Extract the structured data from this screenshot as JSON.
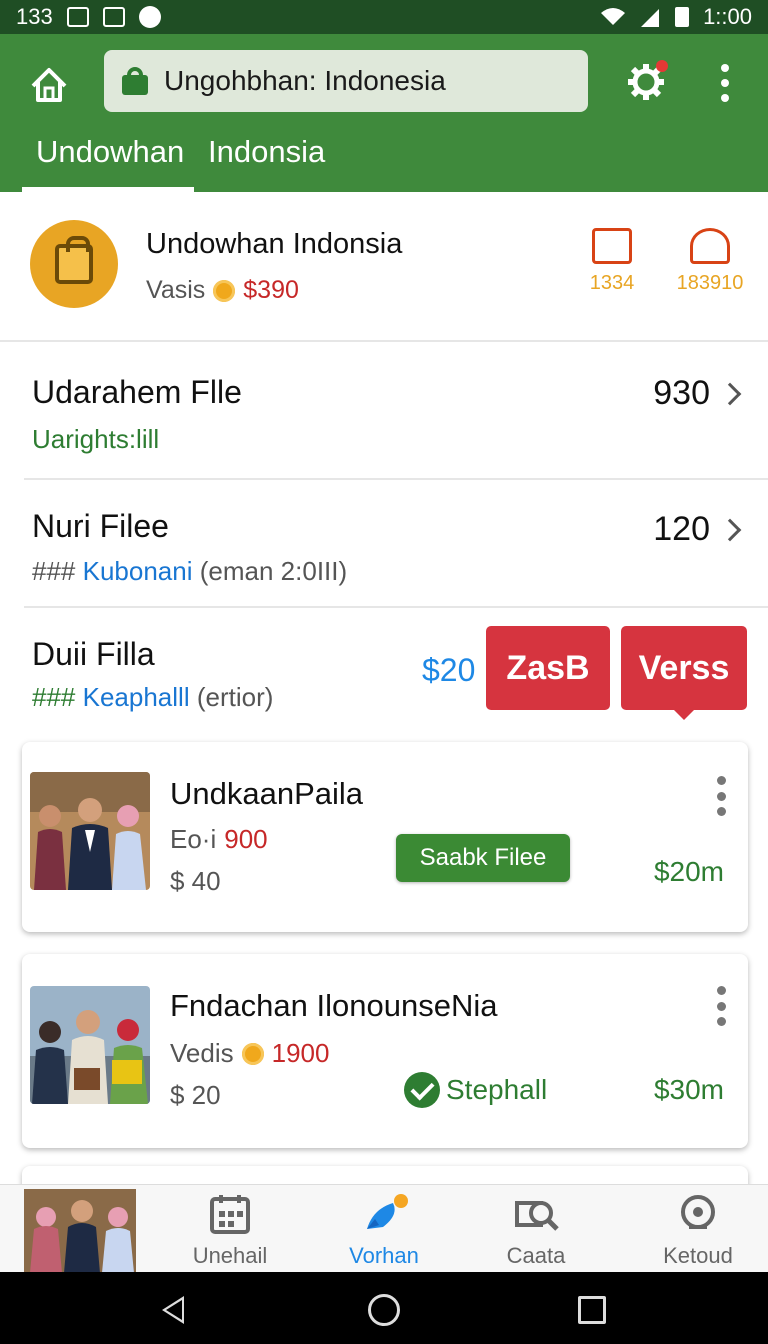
{
  "status_bar": {
    "left_text": "133",
    "time": "1::00"
  },
  "app_bar": {
    "url": "Ungohbhan: Indonesia",
    "tabs": [
      {
        "label": "Undowhan",
        "active": true
      },
      {
        "label": "Indonsia",
        "active": false
      }
    ]
  },
  "profile": {
    "name": "Undowhan Indonsia",
    "sub_label": "Vasis",
    "amount": "$390",
    "stats": [
      {
        "value": "1334"
      },
      {
        "value": "183910"
      }
    ]
  },
  "rows": [
    {
      "title": "Udarahem Flle",
      "sub": "Uarights:lill",
      "value": "930"
    },
    {
      "title": "Nuri Filee",
      "sub_prefix": "###",
      "sub_link": "Kubonani",
      "sub_extra": "(eman 2:0III)",
      "value": "120"
    },
    {
      "title": "Duii Filla",
      "sub_prefix": "###",
      "sub_link": "Keaphalll",
      "sub_extra": "(ertior)",
      "price": "$20",
      "btn1": "ZasB",
      "btn2": "Verss"
    }
  ],
  "cards": [
    {
      "title": "UndkaanPaila",
      "line1_label": "Eo·i",
      "line1_value": "900",
      "line2": "$ 40",
      "action": "Saabk Filee",
      "price": "$20m"
    },
    {
      "title": "Fndachan IlonounseNia",
      "line1_label": "Vedis",
      "line1_value": "1900",
      "line2": "$ 20",
      "action": "Stephall",
      "price": "$30m"
    }
  ],
  "bottom_nav": [
    {
      "label": "Unehail",
      "icon": "calendar-icon",
      "active": false
    },
    {
      "label": "Vorhan",
      "icon": "rocket-icon",
      "active": true
    },
    {
      "label": "Caata",
      "icon": "search-icon",
      "active": false
    },
    {
      "label": "Ketoud",
      "icon": "compass-icon",
      "active": false
    }
  ],
  "colors": {
    "app_bar": "#3f8a3c",
    "status_bar": "#1f4e24",
    "accent_red": "#d6343f",
    "accent_blue": "#1e88e5",
    "green_text": "#2e7d32"
  }
}
